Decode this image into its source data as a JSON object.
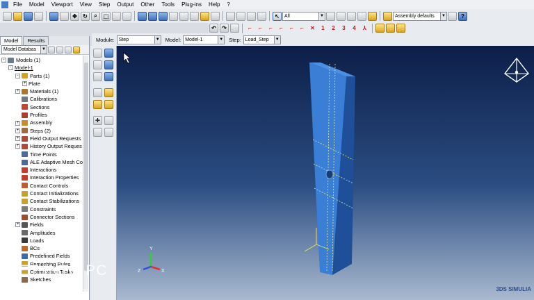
{
  "menu": [
    "File",
    "Model",
    "Viewport",
    "View",
    "Step",
    "Output",
    "Other",
    "Tools",
    "Plug-ins",
    "Help",
    "?"
  ],
  "toolbar": {
    "selection_filter": "All",
    "render_style": "Assembly defaults",
    "dof_labels": [
      "1",
      "2",
      "3",
      "4"
    ]
  },
  "context_bar": {
    "module_label": "Module:",
    "module_value": "Step",
    "model_label": "Model:",
    "model_value": "Model-1",
    "step_label": "Step:",
    "step_value": "Load_Step"
  },
  "panel": {
    "tabs": [
      "Model",
      "Results"
    ],
    "database_label": "Model Databas"
  },
  "tree": [
    {
      "label": "Models (1)",
      "level": 0,
      "expander": "-",
      "icon": "#6a7a93"
    },
    {
      "label": "Model-1",
      "level": 1,
      "expander": "-",
      "icon": "",
      "underline": true
    },
    {
      "label": "Parts (1)",
      "level": 2,
      "expander": "-",
      "icon": "#d8a020"
    },
    {
      "label": "Plate",
      "level": 3,
      "expander": "+",
      "icon": ""
    },
    {
      "label": "Materials (1)",
      "level": 2,
      "expander": "+",
      "icon": "#b0742a"
    },
    {
      "label": "Calibrations",
      "level": 2,
      "expander": "",
      "icon": "#707a86"
    },
    {
      "label": "Sections",
      "level": 2,
      "expander": "",
      "icon": "#c0472c"
    },
    {
      "label": "Profiles",
      "level": 2,
      "expander": "",
      "icon": "#b23a2a"
    },
    {
      "label": "Assembly",
      "level": 2,
      "expander": "+",
      "icon": "#c98b2c"
    },
    {
      "label": "Steps (2)",
      "level": 2,
      "expander": "+",
      "icon": "#a06a3c"
    },
    {
      "label": "Field Output Requests",
      "level": 2,
      "expander": "+",
      "icon": "#b04a36"
    },
    {
      "label": "History Output Reques",
      "level": 2,
      "expander": "+",
      "icon": "#b04a36"
    },
    {
      "label": "Time Points",
      "level": 2,
      "expander": "",
      "icon": "#4a6a9a"
    },
    {
      "label": "ALE Adaptive Mesh Co",
      "level": 2,
      "expander": "",
      "icon": "#4a6a9a"
    },
    {
      "label": "Interactions",
      "level": 2,
      "expander": "",
      "icon": "#c83a2a"
    },
    {
      "label": "Interaction Properties",
      "level": 2,
      "expander": "",
      "icon": "#c83a2a"
    },
    {
      "label": "Contact Controls",
      "level": 2,
      "expander": "",
      "icon": "#c05a2a"
    },
    {
      "label": "Contact Initializations",
      "level": 2,
      "expander": "",
      "icon": "#c9a02c"
    },
    {
      "label": "Contact Stabilizations",
      "level": 2,
      "expander": "",
      "icon": "#c9a02c"
    },
    {
      "label": "Constraints",
      "level": 2,
      "expander": "",
      "icon": "#7a7a7a"
    },
    {
      "label": "Connector Sections",
      "level": 2,
      "expander": "",
      "icon": "#a04a2a"
    },
    {
      "label": "Fields",
      "level": 2,
      "expander": "+",
      "icon": "#555555"
    },
    {
      "label": "Amplitudes",
      "level": 2,
      "expander": "",
      "icon": "#6a6a6a"
    },
    {
      "label": "Loads",
      "level": 2,
      "expander": "",
      "icon": "#3a3a3a"
    },
    {
      "label": "BCs",
      "level": 2,
      "expander": "",
      "icon": "#c06a2a"
    },
    {
      "label": "Predefined Fields",
      "level": 2,
      "expander": "",
      "icon": "#3a6ab0"
    },
    {
      "label": "Remeshing Rules",
      "level": 2,
      "expander": "",
      "icon": "#c9a02c"
    },
    {
      "label": "Optimization Tasks",
      "level": 2,
      "expander": "",
      "icon": "#c9a02c"
    },
    {
      "label": "Sketches",
      "level": 2,
      "expander": "",
      "icon": "#8a6a4a"
    }
  ],
  "watermark": {
    "title": "GET INTO PC",
    "subtitle": "Download Free Your Desired App"
  },
  "brand": "3DS SIMULIA",
  "triad": {
    "x": "X",
    "y": "Y",
    "z": "Z"
  }
}
